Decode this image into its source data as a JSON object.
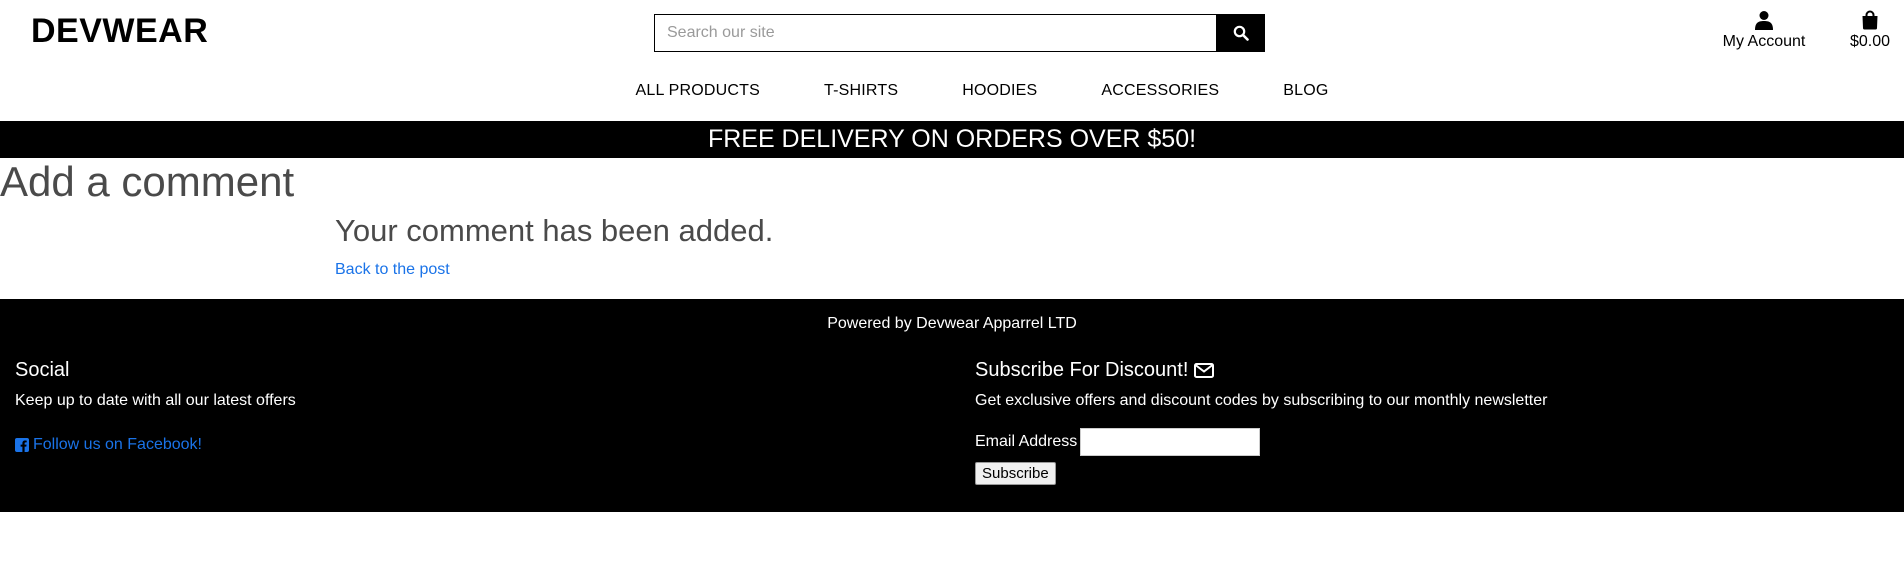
{
  "brand": {
    "logo": "DEVWEAR"
  },
  "search": {
    "placeholder": "Search our site"
  },
  "header": {
    "account_label": "My Account",
    "cart_total": "$0.00"
  },
  "nav": {
    "items": [
      {
        "label": "ALL PRODUCTS"
      },
      {
        "label": "T-SHIRTS"
      },
      {
        "label": "HOODIES"
      },
      {
        "label": "ACCESSORIES"
      },
      {
        "label": "BLOG"
      }
    ]
  },
  "banner": {
    "text": "FREE DELIVERY ON ORDERS OVER $50!"
  },
  "main": {
    "title": "Add a comment",
    "message": "Your comment has been added.",
    "back_link": "Back to the post"
  },
  "footer": {
    "powered": "Powered by Devwear Apparrel LTD",
    "social": {
      "heading": "Social",
      "text": "Keep up to date with all our latest offers",
      "facebook_link": "Follow us on Facebook!"
    },
    "subscribe": {
      "heading": "Subscribe For Discount!",
      "text": "Get exclusive offers and discount codes by subscribing to our monthly newsletter",
      "email_label": "Email Address",
      "email_value": "",
      "button": "Subscribe"
    }
  },
  "colors": {
    "accent_link": "#1a73e8",
    "banner_bg": "#000000",
    "footer_bg": "#000000"
  },
  "icons": {
    "search": "search-icon",
    "account": "user-icon",
    "cart": "shopping-bag-icon",
    "facebook": "facebook-icon",
    "envelope": "envelope-icon"
  }
}
